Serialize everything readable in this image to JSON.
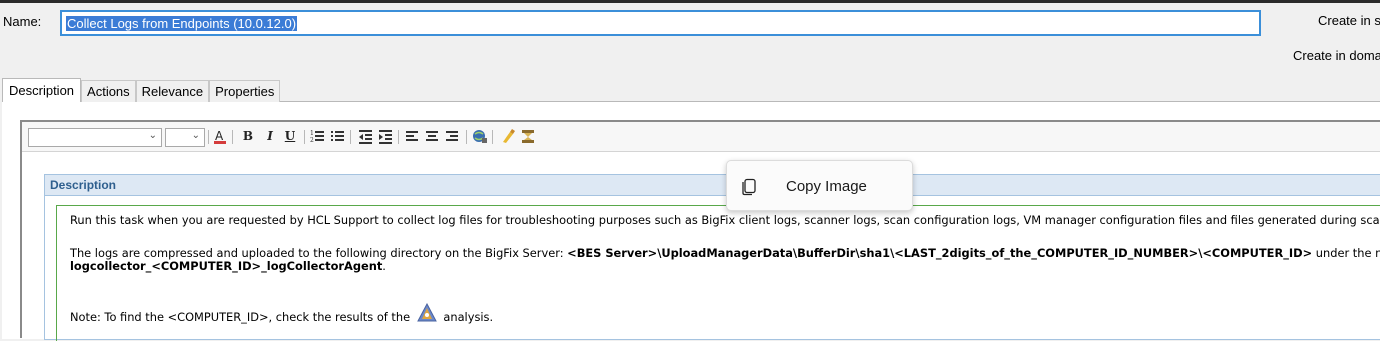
{
  "header": {
    "name_label": "Name:",
    "name_value": "Collect Logs from Endpoints (10.0.12.0)",
    "create_in_site": "Create in s",
    "create_in_domain": "Create in doma"
  },
  "tabs": [
    {
      "label": "Description",
      "active": true
    },
    {
      "label": "Actions"
    },
    {
      "label": "Relevance"
    },
    {
      "label": "Properties"
    }
  ],
  "toolbar": {
    "font_family_value": "",
    "font_size_value": "",
    "icons": [
      "font-color-icon",
      "bold-icon",
      "italic-icon",
      "underline-icon",
      "numbered-list-icon",
      "bulleted-list-icon",
      "outdent-icon",
      "indent-icon",
      "align-left-icon",
      "align-center-icon",
      "align-right-icon",
      "insert-link-icon",
      "highlight-icon",
      "insert-image-icon"
    ]
  },
  "description": {
    "header": "Description",
    "p1": "Run this task when you are requested by HCL Support to collect log files for troubleshooting purposes such as BigFix client logs, scanner logs, scan configuration logs, VM manager configuration files and files generated during scans.",
    "p2_prefix": "The logs are compressed and uploaded to the following directory on the BigFix Server: ",
    "p2_path": "<BES Server>\\UploadManagerData\\BufferDir\\sha1\\<LAST_2digits_of_the_COMPUTER_ID_NUMBER>\\<COMPUTER_ID>",
    "p2_mid": " under the name",
    "p2_file": "logcollector_<COMPUTER_ID>_logCollectorAgent",
    "p2_end": ".",
    "p3_prefix": "Note: To find the <COMPUTER_ID>, check the results of the ",
    "p3_suffix": " analysis."
  },
  "context_menu": {
    "copy_image": "Copy Image",
    "icon": "copy-icon"
  },
  "colors": {
    "selection": "#3b7cd6",
    "input_border": "#3b8fd9",
    "panel_header": "#dde8f4",
    "panel_header_text": "#2e5f8e",
    "body_border": "#59a84a"
  }
}
